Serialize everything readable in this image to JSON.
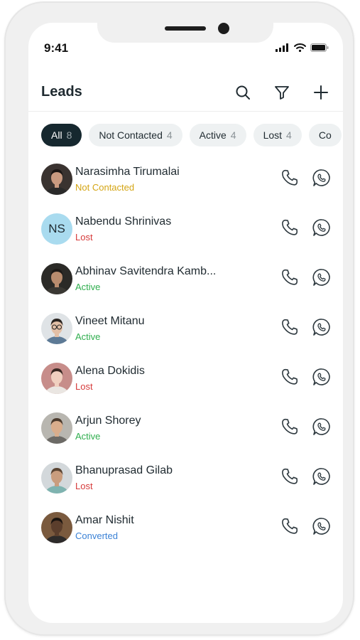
{
  "status_bar": {
    "time": "9:41"
  },
  "header": {
    "title": "Leads"
  },
  "filters": [
    {
      "label": "All",
      "count": "8",
      "selected": true
    },
    {
      "label": "Not Contacted",
      "count": "4",
      "selected": false
    },
    {
      "label": "Active",
      "count": "4",
      "selected": false
    },
    {
      "label": "Lost",
      "count": "4",
      "selected": false
    },
    {
      "label": "Co",
      "count": "",
      "selected": false
    }
  ],
  "colors": {
    "not_contacted": "#d4a514",
    "lost": "#d63a3a",
    "active": "#2fae4e",
    "converted": "#3b82d6"
  },
  "leads": [
    {
      "name": "Narasimha Tirumalai",
      "status": "Not Contacted",
      "status_key": "not_contacted",
      "avatar": "photo"
    },
    {
      "name": "Nabendu Shrinivas",
      "status": "Lost",
      "status_key": "lost",
      "avatar": "initials",
      "initials": "NS"
    },
    {
      "name": "Abhinav Savitendra Kamb...",
      "status": "Active",
      "status_key": "active",
      "avatar": "photo"
    },
    {
      "name": "Vineet Mitanu",
      "status": "Active",
      "status_key": "active",
      "avatar": "photo"
    },
    {
      "name": "Alena Dokidis",
      "status": "Lost",
      "status_key": "lost",
      "avatar": "photo"
    },
    {
      "name": "Arjun Shorey",
      "status": "Active",
      "status_key": "active",
      "avatar": "photo"
    },
    {
      "name": "Bhanuprasad Gilab",
      "status": "Lost",
      "status_key": "lost",
      "avatar": "photo"
    },
    {
      "name": "Amar Nishit",
      "status": "Converted",
      "status_key": "converted",
      "avatar": "photo"
    }
  ]
}
